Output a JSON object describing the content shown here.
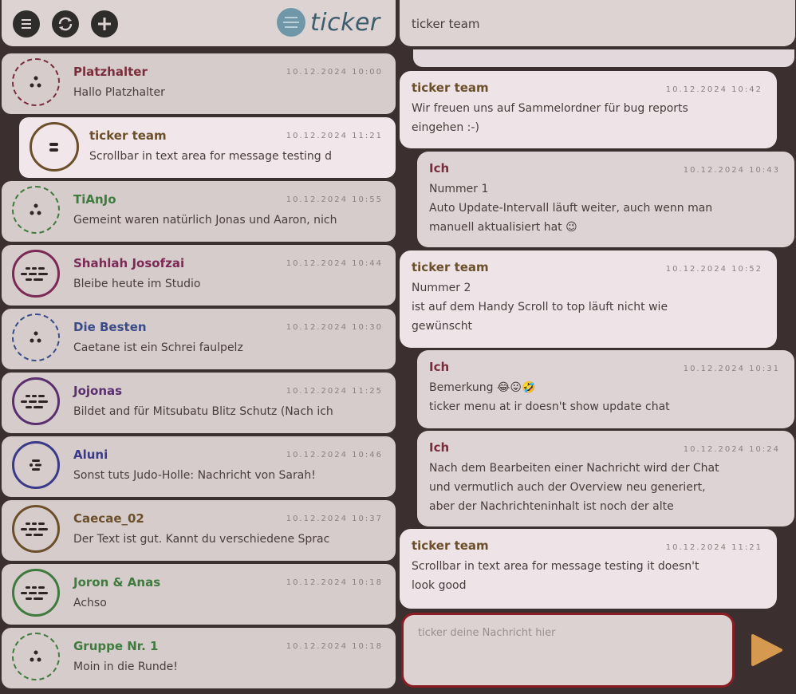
{
  "header": {
    "brand_name": "ticker",
    "icons": [
      "menu-icon",
      "refresh-icon",
      "add-icon"
    ]
  },
  "colors": {
    "background": "#3c2f2f",
    "panel": "#d6cccc",
    "active_panel": "#f1e6ea",
    "composer_border": "#8a1d24",
    "send_button": "#d59a4f"
  },
  "chats": [
    {
      "name": "Platzhalter",
      "time": "10.12.2024 10:00",
      "preview": "Hallo Platzhalter",
      "color": "#7a2d3a",
      "dots": "few",
      "avatar_style": "dashed"
    },
    {
      "name": "ticker team",
      "time": "10.12.2024 11:21",
      "preview": "Scrollbar in text area for message testing d",
      "color": "#6b4f2a",
      "dots": "dash",
      "avatar_style": "solid"
    },
    {
      "name": "TiAnJo",
      "time": "10.12.2024 10:55",
      "preview": "Gemeint waren natürlich Jonas und Aaron, nich",
      "color": "#3f7a3f",
      "dots": "few",
      "avatar_style": "dashed"
    },
    {
      "name": "Shahlah Josofzai",
      "time": "10.12.2024 10:44",
      "preview": "Bleibe heute im Studio",
      "color": "#7a2a55",
      "dots": "many",
      "avatar_style": "solid"
    },
    {
      "name": "Die Besten",
      "time": "10.12.2024 10:30",
      "preview": "Caetane ist ein Schrei faulpelz",
      "color": "#3a4c88",
      "dots": "few",
      "avatar_style": "dashed"
    },
    {
      "name": "Jojonas",
      "time": "10.12.2024 11:25",
      "preview": "Bildet and für Mitsubatu Blitz Schutz (Nach ich",
      "color": "#5a2f6e",
      "dots": "many",
      "avatar_style": "solid"
    },
    {
      "name": "Aluni",
      "time": "10.12.2024 10:46",
      "preview": "Sonst tuts Judo-Holle: Nachricht von Sarah!",
      "color": "#3a3a88",
      "dots": "mid",
      "avatar_style": "solid"
    },
    {
      "name": "Caecae_02",
      "time": "10.12.2024 10:37",
      "preview": "Der Text ist gut. Kannt du verschiedene Sprac",
      "color": "#6b4f2a",
      "dots": "many",
      "avatar_style": "solid"
    },
    {
      "name": "Joron & Anas",
      "time": "10.12.2024 10:18",
      "preview": "Achso",
      "color": "#3f7a3f",
      "dots": "many",
      "avatar_style": "solid"
    },
    {
      "name": "Gruppe Nr. 1",
      "time": "10.12.2024 10:18",
      "preview": "Moin in die Runde!",
      "color": "#3f7a3f",
      "dots": "few",
      "avatar_style": "dashed"
    }
  ],
  "conversation": {
    "title": "ticker team",
    "messages": [
      {
        "sender": "ticker team",
        "time": "10.12.2024 10:42",
        "lines": [
          "Wir freuen uns auf Sammelordner für bug reports",
          "eingehen :-)"
        ],
        "type": "recv"
      },
      {
        "sender": "Ich",
        "time": "10.12.2024 10:43",
        "lines": [
          "Nummer 1",
          "Auto Update-Intervall läuft weiter, auch wenn man",
          "manuell aktualisiert hat 😉"
        ],
        "type": "sent"
      },
      {
        "sender": "ticker team",
        "time": "10.12.2024 10:52",
        "lines": [
          "Nummer 2",
          "ist auf dem Handy Scroll to top läuft nicht wie",
          "gewünscht"
        ],
        "type": "recv"
      },
      {
        "sender": "Ich",
        "time": "10.12.2024 10:31",
        "lines": [
          "Bemerkung 😂😛🤣",
          "ticker menu at ir doesn't show update chat"
        ],
        "type": "sent"
      },
      {
        "sender": "Ich",
        "time": "10.12.2024 10:24",
        "lines": [
          "Nach dem Bearbeiten einer Nachricht wird der Chat",
          "und vermutlich auch der Overview neu generiert,",
          "aber der Nachrichteninhalt ist noch der alte"
        ],
        "type": "sent"
      },
      {
        "sender": "ticker team",
        "time": "10.12.2024 11:21",
        "lines": [
          "Scrollbar in text area for message testing it doesn't",
          "look good"
        ],
        "type": "recv"
      }
    ]
  },
  "composer": {
    "placeholder": "ticker deine Nachricht hier"
  }
}
